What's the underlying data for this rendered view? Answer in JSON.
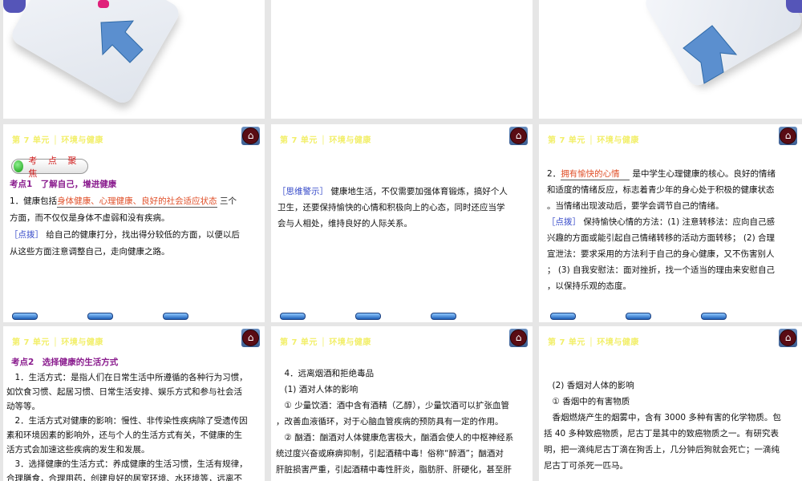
{
  "header": "第 7 单元 │ 环境与健康",
  "home_icon": "home-icon",
  "slides": {
    "s1": {
      "badge": "考 点 聚 焦",
      "heading": "考点1　了解自己，增进健康",
      "l1a": "1．健康包括",
      "l1ans": "身体健康、心理健康、良好的社会适应状态",
      "l1b": " 三个",
      "l2": "方面，而不仅仅是身体不虚弱和没有疾病。",
      "tip": "［点拨］",
      "l3": " 给自己的健康打分，找出得分较低的方面，以便以后",
      "l4": "从这些方面注意调整自己，走向健康之路。"
    },
    "s2": {
      "tip": "［思维警示］",
      "l1": " 健康地生活，不仅需要加强体育锻炼，搞好个人",
      "l2": "卫生，还要保持愉快的心情和积极向上的心态，同时还应当学",
      "l3": "会与人相处，维持良好的人际关系。"
    },
    "s3": {
      "l1a": "2．",
      "l1ans": "拥有愉快的心情",
      "l1b": " 是中学生心理健康的核心。良好的情绪",
      "l2": "和适度的情绪反应，标志着青少年的身心处于积极的健康状态",
      "l3": "。当情绪出现波动后，要学会调节自己的情绪。",
      "tip": "［点拨］",
      "l4": " 保持愉快心情的方法：(1) 注意转移法：应向自己感",
      "l5": "兴趣的方面或能引起自己情绪转移的活动方面转移； (2) 合理",
      "l6": "宣泄法：要求采用的方法利于自己的身心健康，又不伤害别人",
      "l7": "； (3) 自我安慰法：面对挫折，找一个适当的理由来安慰自己",
      "l8": "，以保持乐观的态度。"
    },
    "s4": {
      "heading": "考点2　选择健康的生活方式",
      "lines": [
        "　1．生活方式：是指人们在日常生活中所遵循的各种行为习惯，",
        "如饮食习惯、起居习惯、日常生活安排、娱乐方式和参与社会活",
        "动等等。",
        "　2．生活方式对健康的影响：慢性、非传染性疾病除了受遗传因",
        "素和环境因素的影响外，还与个人的生活方式有关，不健康的生",
        "活方式会加速这些疾病的发生和发展。",
        "　3．选择健康的生活方式：养成健康的生活习惯，生活有规律，",
        "合理膳食，合理用药，创建良好的居室环境、水环境等，远离不"
      ]
    },
    "s5": {
      "lines": [
        "　4．远离烟酒和拒绝毒品",
        "　(1) 酒对人体的影响",
        "　① 少量饮酒：酒中含有酒精（乙醇），少量饮酒可以扩张血管",
        "，改善血液循环，对于心脑血管疾病的预防具有一定的作用。",
        "　② 酗酒：酗酒对人体健康危害极大，酗酒会使人的中枢神经系",
        "统过度兴奋或麻痹抑制，引起酒精中毒！俗称“醉酒”；酗酒对",
        "肝脏损害严重，引起酒精中毒性肝炎，脂肪肝、肝硬化，甚至肝"
      ]
    },
    "s6": {
      "lines": [
        "　(2) 香烟对人体的影响",
        "　① 香烟中的有害物质",
        "　香烟燃烧产生的烟雾中，含有 3000 多种有害的化学物质。包",
        "括 40 多种致癌物质，尼古丁是其中的致癌物质之一。有研究表",
        "明，把一滴纯尼古丁滴在狗舌上，几分钟后狗就会死亡；一滴纯",
        "尼古丁可杀死一匹马。"
      ]
    }
  }
}
